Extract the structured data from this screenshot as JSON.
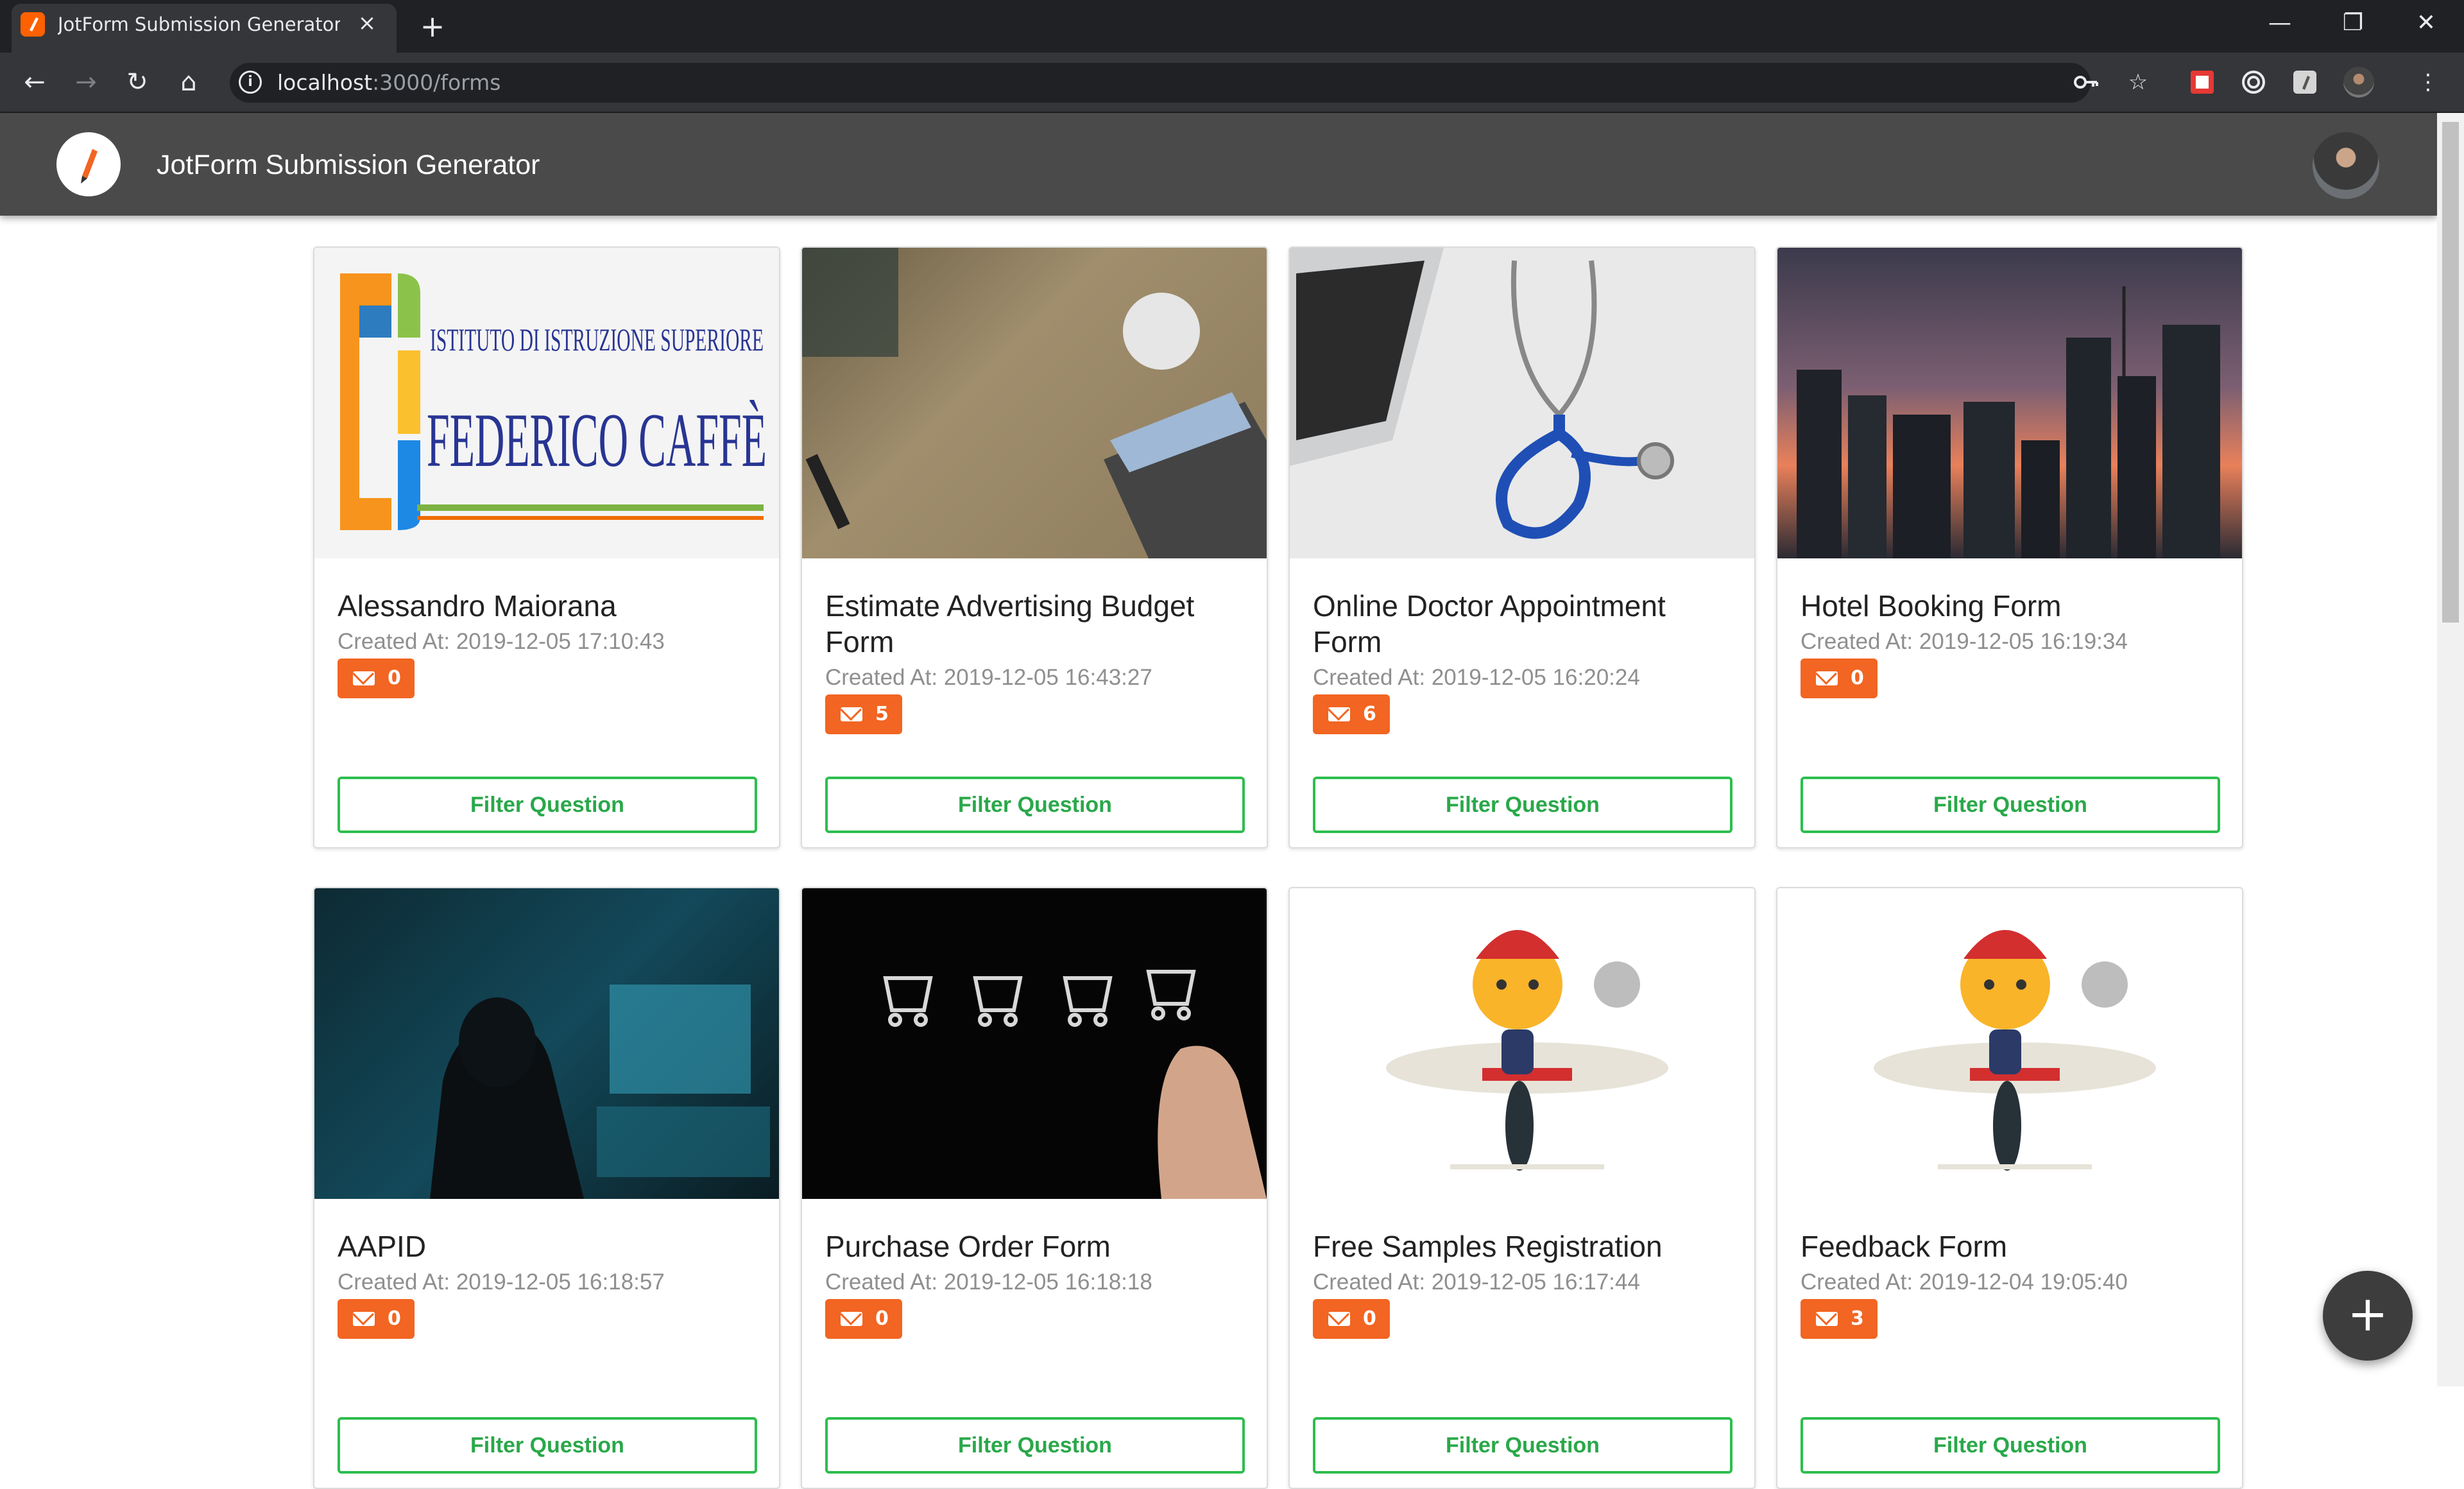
{
  "browser": {
    "tab_title": "JotForm Submission Generator",
    "url_host": "localhost",
    "url_path": ":3000/forms",
    "minimize": "—",
    "restore": "❐",
    "close": "✕",
    "new_tab": "+",
    "tab_close": "×",
    "back": "←",
    "forward": "→",
    "reload": "↻",
    "home": "⌂"
  },
  "app": {
    "title": "JotForm Submission Generator"
  },
  "cards": [
    {
      "title": "Alessandro Maiorana",
      "created": "Created At: 2019-12-05 17:10:43",
      "count": "0",
      "button": "Filter Question",
      "image_texts": [
        "ISTITUTO DI ISTRUZIONE SUPERIORE",
        "FEDERICO CAFFÈ"
      ]
    },
    {
      "title": "Estimate Advertising Budget Form",
      "created": "Created At: 2019-12-05 16:43:27",
      "count": "5",
      "button": "Filter Question"
    },
    {
      "title": "Online Doctor Appointment Form",
      "created": "Created At: 2019-12-05 16:20:24",
      "count": "6",
      "button": "Filter Question"
    },
    {
      "title": "Hotel Booking Form",
      "created": "Created At: 2019-12-05 16:19:34",
      "count": "0",
      "button": "Filter Question"
    },
    {
      "title": "AAPID",
      "created": "Created At: 2019-12-05 16:18:57",
      "count": "0",
      "button": "Filter Question"
    },
    {
      "title": "Purchase Order Form",
      "created": "Created At: 2019-12-05 16:18:18",
      "count": "0",
      "button": "Filter Question"
    },
    {
      "title": "Free Samples Registration",
      "created": "Created At: 2019-12-05 16:17:44",
      "count": "0",
      "button": "Filter Question"
    },
    {
      "title": "Feedback Form",
      "created": "Created At: 2019-12-04 19:05:40",
      "count": "3",
      "button": "Filter Question"
    }
  ],
  "fab": {
    "label": "+"
  },
  "colors": {
    "badge": "#f26522",
    "filter_border": "#2dbe4e",
    "appbar": "#4a4a4a"
  }
}
